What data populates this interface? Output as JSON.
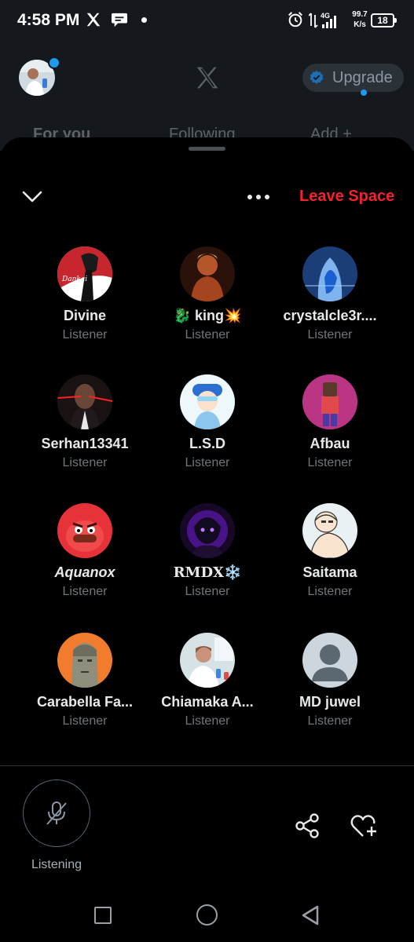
{
  "status_bar": {
    "time": "4:58 PM",
    "network": "4G",
    "speed_value": "99.7",
    "speed_unit": "K/s",
    "battery": "18",
    "icons": [
      "x-logo-icon",
      "chat-bubble-icon",
      "alarm-icon",
      "signal-icon",
      "battery-icon"
    ]
  },
  "app_header": {
    "upgrade_label": "Upgrade",
    "tabs": [
      {
        "label": "For you"
      },
      {
        "label": "Following"
      },
      {
        "label": "Add +"
      }
    ]
  },
  "space": {
    "leave_label": "Leave Space",
    "participants": [
      {
        "name": "Divine",
        "role": "Listener",
        "avatar_color": "#c7262e"
      },
      {
        "name": "🐉 king💥",
        "role": "Listener",
        "avatar_color": "#8a3a1c"
      },
      {
        "name": "crystalcle3r....",
        "role": "Listener",
        "avatar_color": "#3b74c4"
      },
      {
        "name": "Serhan13341",
        "role": "Listener",
        "avatar_color": "#2a1a18"
      },
      {
        "name": "L.S.D",
        "role": "Listener",
        "avatar_color": "#6fc3e8"
      },
      {
        "name": "Afbau",
        "role": "Listener",
        "avatar_color": "#b83a8a"
      },
      {
        "name": "Aquanox",
        "role": "Listener",
        "avatar_color": "#e23a3f"
      },
      {
        "name": "RMDX❄️",
        "role": "Listener",
        "avatar_color": "#5a1aa8"
      },
      {
        "name": "Saitama",
        "role": "Listener",
        "avatar_color": "#d9e6ef"
      },
      {
        "name": "Carabella Fa...",
        "role": "Listener",
        "avatar_color": "#f07a2a"
      },
      {
        "name": "Chiamaka A...",
        "role": "Listener",
        "avatar_color": "#c9d6dd"
      },
      {
        "name": "MD juwel",
        "role": "Listener",
        "avatar_color": "#c8d0d6"
      }
    ],
    "mic_label": "Listening"
  },
  "colors": {
    "accent": "#1d9bf0",
    "danger": "#f4212e",
    "muted_text": "#71767b"
  }
}
